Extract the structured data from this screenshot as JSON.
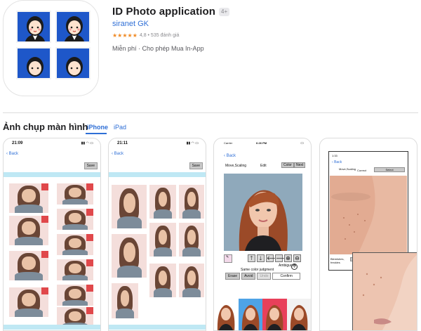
{
  "app": {
    "title": "ID Photo application",
    "age_rating": "4+",
    "developer": "siranet GK",
    "stars": "★★★★★",
    "rating_text": "4,8 • 535 đánh giá",
    "price_text": "Miễn phí · Cho phép Mua In-App"
  },
  "screenshots": {
    "section_title": "Ảnh chụp màn hình",
    "tabs": [
      {
        "label": "iPhone",
        "selected": true
      },
      {
        "label": "iPad",
        "selected": false
      }
    ],
    "shot1": {
      "time": "21:09",
      "back": "Back",
      "save": "Save"
    },
    "shot2": {
      "time": "21:11",
      "back": "Back",
      "save": "Save"
    },
    "shot3": {
      "carrier": "Carrier",
      "time": "6:26 PM",
      "back": "Back",
      "move_scaling": "Move,Scaling",
      "edit": "Edit",
      "color": "Color",
      "next": "Next",
      "ambiguous": "Ambiguous",
      "same_color": "Same color judgment",
      "erase": "Erase",
      "avoid": "Avoid",
      "undo": "Undo",
      "confirm": "Confirm"
    },
    "shot4": {
      "time": "1:33",
      "back": "Back",
      "move_scaling": "Move,Scaling",
      "correct": "Correct",
      "select": "Select",
      "blemishes": "Blemishes, freckles"
    }
  },
  "colors": {
    "accent": "#2f6fd6",
    "icon_blue": "#1e57c9",
    "star": "#f08a24",
    "cyan_bar": "#bfe8f4",
    "red_mark": "#e0484b"
  }
}
